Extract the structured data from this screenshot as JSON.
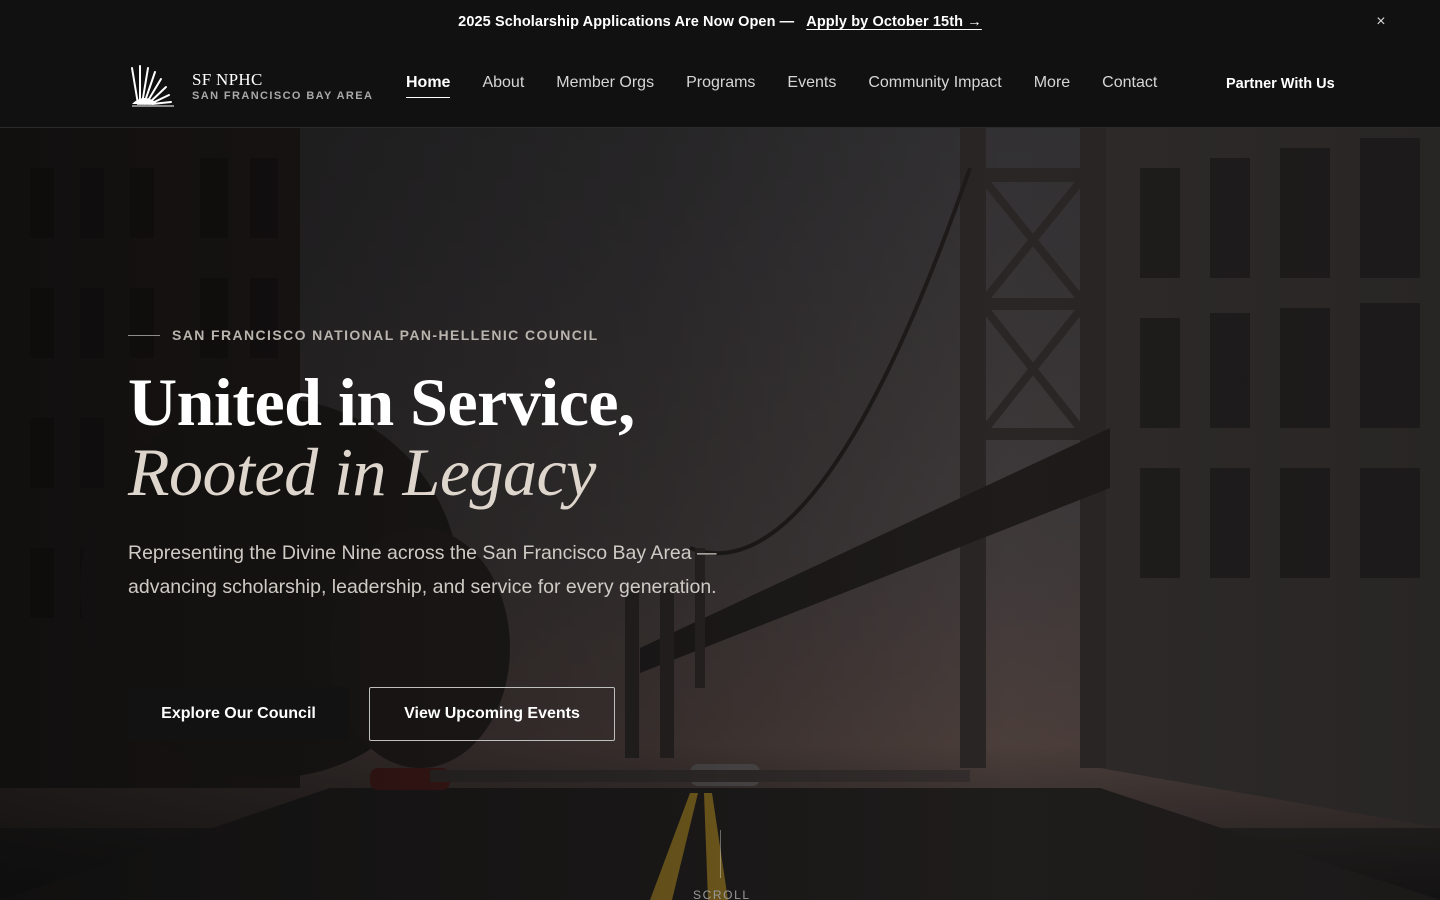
{
  "announcement": {
    "message": "2025 Scholarship Applications Are Now Open —",
    "cta": "Apply by October 15th →",
    "close_label": "×"
  },
  "header": {
    "logo": {
      "name": "SF NPHC",
      "subtitle": "SAN FRANCISCO BAY AREA",
      "icon": "sunburst-logo-icon"
    },
    "nav": [
      {
        "label": "Home",
        "active": true
      },
      {
        "label": "About"
      },
      {
        "label": "Member Orgs"
      },
      {
        "label": "Programs"
      },
      {
        "label": "Events"
      },
      {
        "label": "Community Impact"
      },
      {
        "label": "More"
      },
      {
        "label": "Contact"
      }
    ],
    "partner_label": "Partner With Us"
  },
  "hero": {
    "eyebrow": "SAN FRANCISCO NATIONAL PAN-HELLENIC COUNCIL",
    "title_line1": "United in Service,",
    "title_line2": "Rooted in Legacy",
    "lead": "Representing the Divine Nine across the San Francisco Bay Area — advancing scholarship, leadership, and service for every generation.",
    "primary_button": "Explore Our Council",
    "secondary_button": "View Upcoming Events",
    "scroll_label": "SCROLL",
    "background": "bay-bridge-photo"
  },
  "colors": {
    "bar_bg": "#111111",
    "text_primary": "#ffffff",
    "text_muted": "#cfcac4",
    "accent_italic": "#ded6cc"
  }
}
